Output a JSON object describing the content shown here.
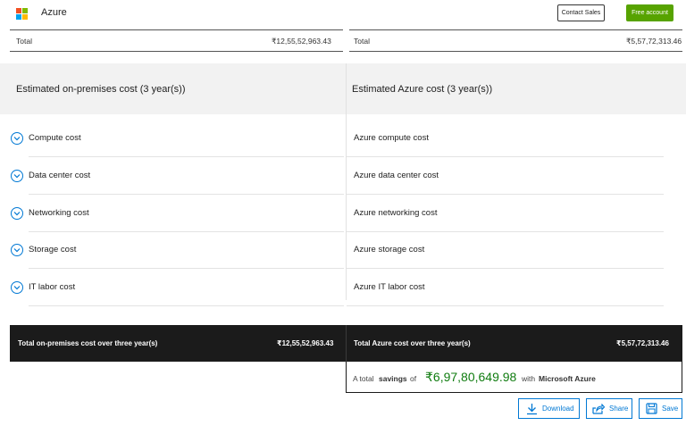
{
  "header": {
    "brand": "Azure",
    "contact_sales": "Contact Sales",
    "free_account": "Free account"
  },
  "top_totals": {
    "left_label": "Total",
    "left_value": "₹12,55,52,963.43",
    "right_label": "Total",
    "right_value": "₹5,57,72,313.46"
  },
  "columns": {
    "on_prem_title": "Estimated on-premises cost (3 year(s))",
    "azure_title": "Estimated Azure cost (3 year(s))"
  },
  "on_prem_items": [
    {
      "label": "Compute cost"
    },
    {
      "label": "Data center cost"
    },
    {
      "label": "Networking cost"
    },
    {
      "label": "Storage cost"
    },
    {
      "label": "IT labor cost"
    }
  ],
  "azure_items": [
    {
      "label": "Azure compute cost"
    },
    {
      "label": "Azure data center cost"
    },
    {
      "label": "Azure networking cost"
    },
    {
      "label": "Azure storage cost"
    },
    {
      "label": "Azure IT labor cost"
    }
  ],
  "totals_bar": {
    "on_prem_label": "Total on-premises cost over three year(s)",
    "on_prem_value": "₹12,55,52,963.43",
    "azure_label": "Total Azure cost over three year(s)",
    "azure_value": "₹5,57,72,313.46"
  },
  "savings": {
    "prefix": "A total",
    "keyword": "savings",
    "of": "of",
    "amount": "₹6,97,80,649.98",
    "with": "with",
    "brand": "Microsoft Azure"
  },
  "actions": {
    "download": "Download",
    "share": "Share",
    "save": "Save"
  },
  "icons": {
    "expand": "chevron-down-circle-icon",
    "download": "download-icon",
    "share": "share-icon",
    "save": "save-icon"
  },
  "colors": {
    "accent": "#0078d4",
    "free_account_bg": "#57a300",
    "savings_green": "#107c10",
    "totals_bar_bg": "#1b1b1b",
    "logo_red": "#f25022",
    "logo_green": "#7fba00",
    "logo_blue": "#00a4ef",
    "logo_yellow": "#ffb900"
  }
}
